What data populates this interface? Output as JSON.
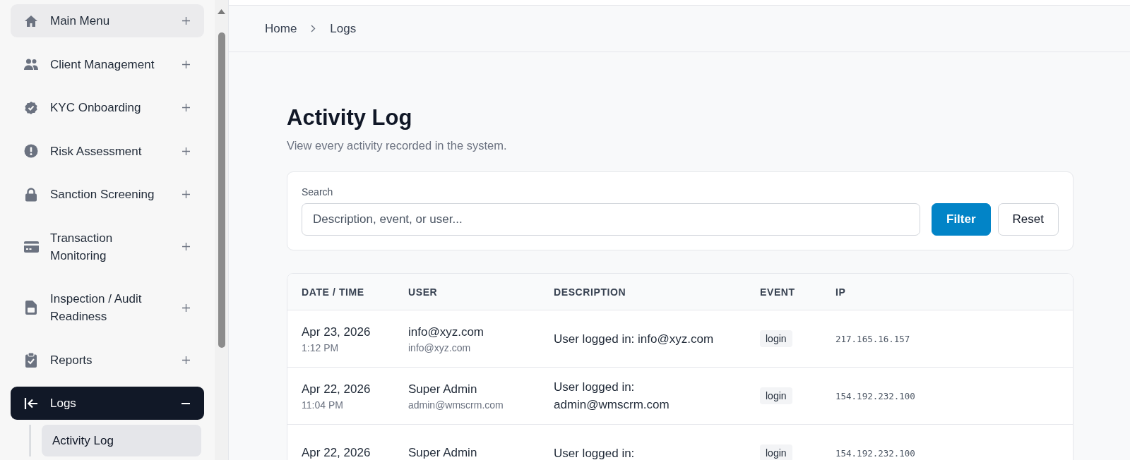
{
  "sidebar": {
    "items": [
      {
        "label": "Main Menu",
        "hovered": true,
        "selected": false,
        "expanded": false
      },
      {
        "label": "Client Management",
        "hovered": false,
        "selected": false,
        "expanded": false
      },
      {
        "label": "KYC Onboarding",
        "hovered": false,
        "selected": false,
        "expanded": false
      },
      {
        "label": "Risk Assessment",
        "hovered": false,
        "selected": false,
        "expanded": false
      },
      {
        "label": "Sanction Screening",
        "hovered": false,
        "selected": false,
        "expanded": false
      },
      {
        "label": "Transaction Monitoring",
        "hovered": false,
        "selected": false,
        "expanded": false
      },
      {
        "label": "Inspection / Audit Readiness",
        "hovered": false,
        "selected": false,
        "expanded": false
      },
      {
        "label": "Reports",
        "hovered": false,
        "selected": false,
        "expanded": false
      },
      {
        "label": "Logs",
        "hovered": false,
        "selected": true,
        "expanded": true,
        "children": [
          {
            "label": "Activity Log",
            "selected": true
          }
        ]
      }
    ]
  },
  "breadcrumb": [
    "Home",
    "Logs"
  ],
  "page": {
    "title": "Activity Log",
    "subtitle": "View every activity recorded in the system."
  },
  "filter": {
    "label": "Search",
    "placeholder": "Description, event, or user...",
    "buttons": [
      "Filter",
      "Reset"
    ]
  },
  "table": {
    "columns": [
      "DATE / TIME",
      "USER",
      "DESCRIPTION",
      "EVENT",
      "IP"
    ],
    "rows": [
      {
        "date": "Apr 23, 2026",
        "time": "1:12 PM",
        "user_name": "info@xyz.com",
        "user_email": "info@xyz.com",
        "description": "User logged in: info@xyz.com",
        "event": "login",
        "ip": "217.165.16.157"
      },
      {
        "date": "Apr 22, 2026",
        "time": "11:04 PM",
        "user_name": "Super Admin",
        "user_email": "admin@wmscrm.com",
        "description": "User logged in: admin@wmscrm.com",
        "event": "login",
        "ip": "154.192.232.100"
      },
      {
        "date": "Apr 22, 2026",
        "user_name": "Super Admin",
        "description": "User logged in:",
        "event": "login",
        "ip": "154.192.232.100"
      }
    ]
  }
}
